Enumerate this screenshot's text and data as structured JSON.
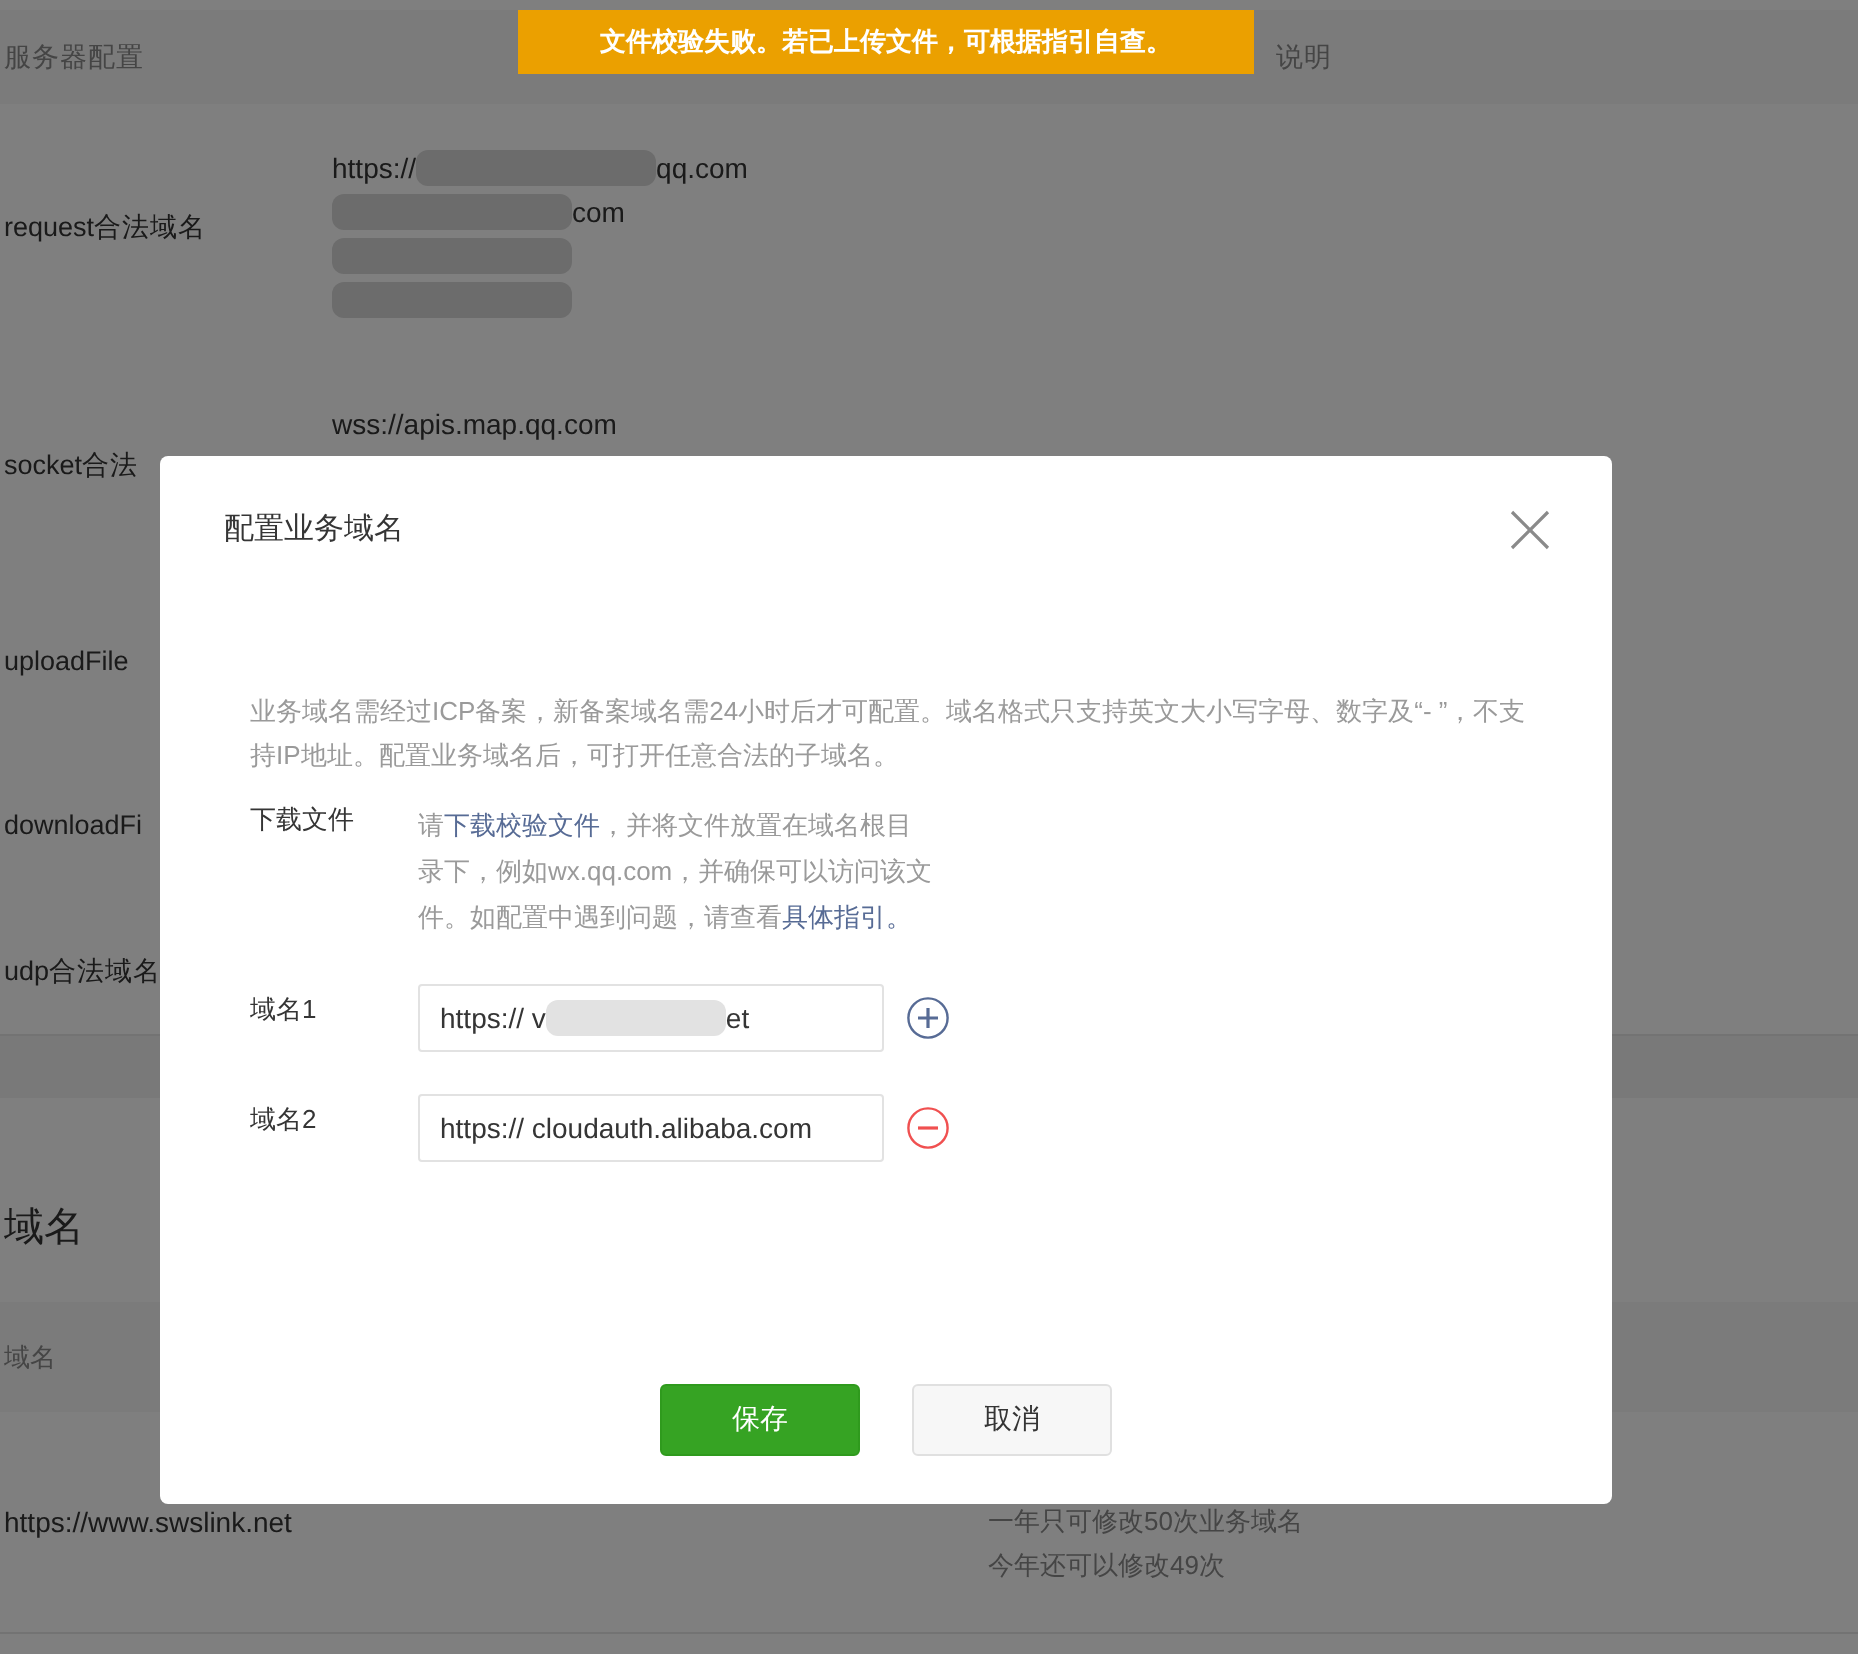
{
  "toast": {
    "text": "文件校验失败。若已上传文件，可根据指引自查。"
  },
  "server_config": {
    "header": {
      "column_1": "服务器配置",
      "column_2": "说明"
    },
    "rows": [
      {
        "label": "request合法域名",
        "lines": [
          [
            {
              "kind": "text",
              "text": "https://"
            },
            {
              "kind": "blur"
            },
            {
              "kind": "text",
              "text": "qq.com"
            }
          ],
          [
            {
              "kind": "blur"
            },
            {
              "kind": "text",
              "text": "com"
            }
          ],
          [
            {
              "kind": "blur"
            }
          ],
          [
            {
              "kind": "blur"
            }
          ]
        ]
      },
      {
        "label": "socket合法",
        "lines": [
          [
            {
              "kind": "text",
              "text": "wss://apis.map.qq.com"
            }
          ]
        ]
      },
      {
        "label": "uploadFile",
        "lines": []
      },
      {
        "label": "downloadFi",
        "lines": []
      },
      {
        "label": "udp合法域名",
        "lines": []
      }
    ]
  },
  "domain_section": {
    "title": "域名",
    "columns": [
      "域名"
    ],
    "rows": [
      {
        "domain": "https://www.swslink.net",
        "notes": [
          "一年只可修改50次业务域名",
          "今年还可以修改49次"
        ]
      }
    ]
  },
  "dialog": {
    "title": "配置业务域名",
    "description": "业务域名需经过ICP备案，新备案域名需24小时后才可配置。域名格式只支持英文大小写字母、数字及“- ”，不支持IP地址。配置业务域名后，可打开任意合法的子域名。",
    "download": {
      "label": "下载文件",
      "segments": [
        {
          "kind": "text",
          "text": "请"
        },
        {
          "kind": "link",
          "text": "下载校验文件"
        },
        {
          "kind": "text",
          "text": "，并将文件放置在域名根目录下，例如wx.qq.com，并确保可以访问该文件。如配置中遇到问题，请查看"
        },
        {
          "kind": "link",
          "text": "具体指引。"
        }
      ]
    },
    "domains": [
      {
        "label": "域名1",
        "value": [
          {
            "kind": "text",
            "text": "https:// v"
          },
          {
            "kind": "blur"
          },
          {
            "kind": "text",
            "text": "et"
          }
        ],
        "kind": "add"
      },
      {
        "label": "域名2",
        "value": [
          {
            "kind": "text",
            "text": "https:// cloudauth.alibaba.com"
          }
        ],
        "kind": "remove"
      }
    ],
    "buttons": [
      {
        "label": "保存",
        "kind": "primary"
      },
      {
        "label": "取消",
        "kind": "default"
      }
    ]
  }
}
